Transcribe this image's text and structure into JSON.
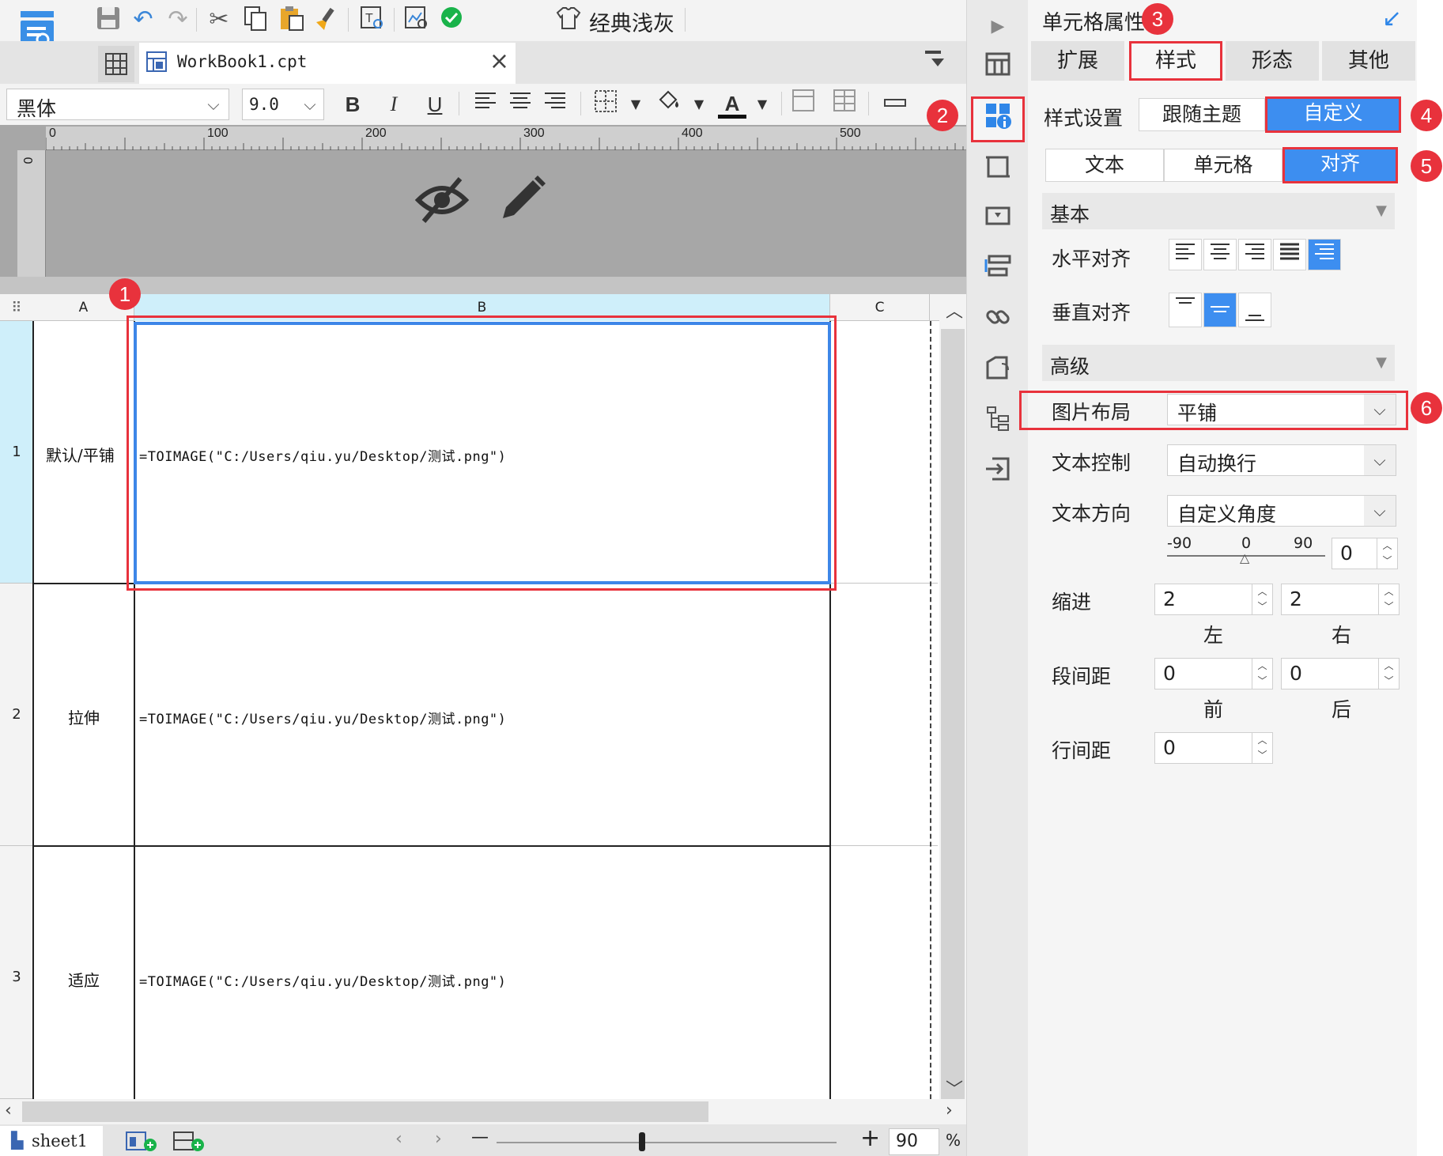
{
  "toolbar": {
    "theme_label": "经典浅灰",
    "icons": [
      "save-icon",
      "undo-icon",
      "redo-icon",
      "cut-icon",
      "copy-icon",
      "paste-icon",
      "format-painter-icon",
      "text-search-icon",
      "preview-icon",
      "check-icon",
      "theme-shirt-icon"
    ]
  },
  "tabs": {
    "workbook_name": "WorkBook1.cpt",
    "close_symbol": "×"
  },
  "format": {
    "font_family": "黑体",
    "font_size": "9.0",
    "bold": "B",
    "italic": "I",
    "underline": "U",
    "font_color_glyph": "A"
  },
  "ruler": {
    "marks": [
      "0",
      "100",
      "200",
      "300",
      "400",
      "500"
    ],
    "vertical_mark": "0"
  },
  "sheet": {
    "columns": [
      "A",
      "B",
      "C"
    ],
    "rows": [
      {
        "number": "1",
        "label": "默认/平铺",
        "formula": "=TOIMAGE(\"C:/Users/qiu.yu/Desktop/测试.png\")"
      },
      {
        "number": "2",
        "label": "拉伸",
        "formula": "=TOIMAGE(\"C:/Users/qiu.yu/Desktop/测试.png\")"
      },
      {
        "number": "3",
        "label": "适应",
        "formula": "=TOIMAGE(\"C:/Users/qiu.yu/Desktop/测试.png\")"
      }
    ],
    "corner_glyph": "⠿"
  },
  "status": {
    "sheet_name": "sheet1",
    "zoom": "90",
    "zoom_unit": "%",
    "minus": "—",
    "plus": "+"
  },
  "panel": {
    "title": "单元格属性",
    "tabs": [
      "扩展",
      "样式",
      "形态",
      "其他"
    ],
    "style_setting_label": "样式设置",
    "style_options": [
      "跟随主题",
      "自定义"
    ],
    "sub_tabs": [
      "文本",
      "单元格",
      "对齐"
    ],
    "basic_section": "基本",
    "horizontal_align_label": "水平对齐",
    "vertical_align_label": "垂直对齐",
    "advanced_section": "高级",
    "image_layout_label": "图片布局",
    "image_layout_value": "平铺",
    "text_control_label": "文本控制",
    "text_control_value": "自动换行",
    "text_direction_label": "文本方向",
    "text_direction_value": "自定义角度",
    "angle_min": "-90",
    "angle_mid": "0",
    "angle_max": "90",
    "angle_value": "0",
    "indent_label": "缩进",
    "indent_left": "2",
    "indent_right": "2",
    "indent_left_caption": "左",
    "indent_right_caption": "右",
    "para_spacing_label": "段间距",
    "para_before": "0",
    "para_after": "0",
    "para_before_caption": "前",
    "para_after_caption": "后",
    "line_spacing_label": "行间距",
    "line_spacing_value": "0"
  },
  "markers": [
    "1",
    "2",
    "3",
    "4",
    "5",
    "6"
  ],
  "colors": {
    "accent_blue": "#3d8ef0",
    "highlight_red": "#e8323c",
    "selected_col_bg": "#cfeffa"
  }
}
